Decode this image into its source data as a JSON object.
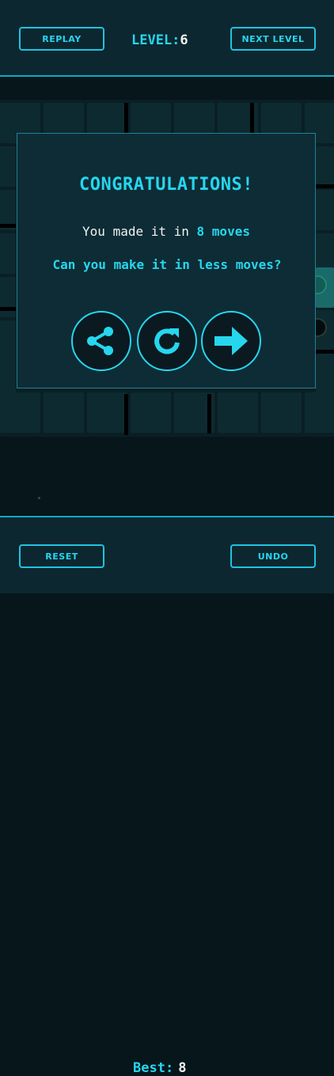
{
  "header": {
    "replay_label": "REPLAY",
    "level_label": "LEVEL:",
    "level_value": "6",
    "next_level_label": "NEXT LEVEL"
  },
  "dialog": {
    "title": "CONGRATULATIONS!",
    "message_prefix": "You made it in",
    "moves_text": "8 moves",
    "question": "Can you make it in less moves?",
    "buttons": [
      {
        "icon": "share-icon"
      },
      {
        "icon": "restart-icon"
      },
      {
        "icon": "arrow-right-icon"
      }
    ]
  },
  "footer": {
    "reset_label": "RESET",
    "best_label": "Best:",
    "best_value": "8",
    "undo_label": "UNDO"
  },
  "colors": {
    "accent": "#26d6ee",
    "panel": "#0e2c35",
    "background": "#07161b"
  }
}
